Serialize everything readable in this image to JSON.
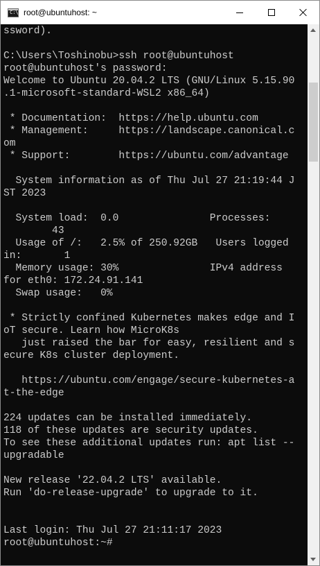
{
  "window": {
    "title": "root@ubuntuhost: ~",
    "icon": "terminal-icon",
    "controls": {
      "minimize_icon": "minimize-icon",
      "maximize_icon": "maximize-icon",
      "close_icon": "close-icon"
    }
  },
  "console": {
    "background": "#0c0c0c",
    "foreground": "#cccccc",
    "lines": [
      "ssword).",
      "",
      "C:\\Users\\Toshinobu>ssh root@ubuntuhost",
      "root@ubuntuhost's password:",
      "Welcome to Ubuntu 20.04.2 LTS (GNU/Linux 5.15.90",
      ".1-microsoft-standard-WSL2 x86_64)",
      "",
      " * Documentation:  https://help.ubuntu.com",
      " * Management:     https://landscape.canonical.c",
      "om",
      " * Support:        https://ubuntu.com/advantage",
      "",
      "  System information as of Thu Jul 27 21:19:44 J",
      "ST 2023",
      "",
      "  System load:  0.0               Processes:",
      "        43",
      "  Usage of /:   2.5% of 250.92GB   Users logged",
      "in:       1",
      "  Memory usage: 30%               IPv4 address",
      "for eth0: 172.24.91.141",
      "  Swap usage:   0%",
      "",
      " * Strictly confined Kubernetes makes edge and I",
      "oT secure. Learn how MicroK8s",
      "   just raised the bar for easy, resilient and s",
      "ecure K8s cluster deployment.",
      "",
      "   https://ubuntu.com/engage/secure-kubernetes-a",
      "t-the-edge",
      "",
      "224 updates can be installed immediately.",
      "118 of these updates are security updates.",
      "To see these additional updates run: apt list --",
      "upgradable",
      "",
      "New release '22.04.2 LTS' available.",
      "Run 'do-release-upgrade' to upgrade to it.",
      "",
      "",
      "Last login: Thu Jul 27 21:11:17 2023",
      "root@ubuntuhost:~#"
    ]
  },
  "scrollbar": {
    "up_icon": "scroll-up-arrow-icon",
    "down_icon": "scroll-down-arrow-icon",
    "thumb_color": "#cdcdcd",
    "track_color": "#f0f0f0"
  }
}
